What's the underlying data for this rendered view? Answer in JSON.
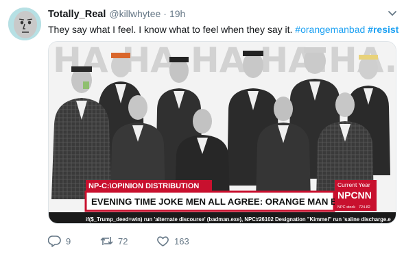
{
  "tweet": {
    "display_name": "Totally_Real",
    "handle": "@killwhytee",
    "separator": "·",
    "time": "19h",
    "text_plain": "They say what I feel. I know what to feel when they say it. ",
    "hashtag_1": "#orangemanbad",
    "hashtag_2": "#resist"
  },
  "image": {
    "ha_text": "HA.HA.HA.HA.HA.HA.",
    "ticker_label": "NP-C:\\OPINION DISTRIBUTION",
    "headline": "EVENING TIME JOKE MEN ALL AGREE: ORANGE MAN BAD",
    "badge_top": "Current Year",
    "badge_logo": "NPCNN",
    "badge_small_left": "NPC stock",
    "badge_small_right": "724.82",
    "crawl": "if($_Trump_deed=win) run 'alternate discourse' (badman.exe), NPC#26102 Designation \"Kimmel\" run 'saline discharge.e"
  },
  "actions": {
    "replies": "9",
    "retweets": "72",
    "likes": "163"
  },
  "colors": {
    "link": "#1da1f2",
    "secondary": "#657786",
    "ticker_red": "#c8102e"
  }
}
